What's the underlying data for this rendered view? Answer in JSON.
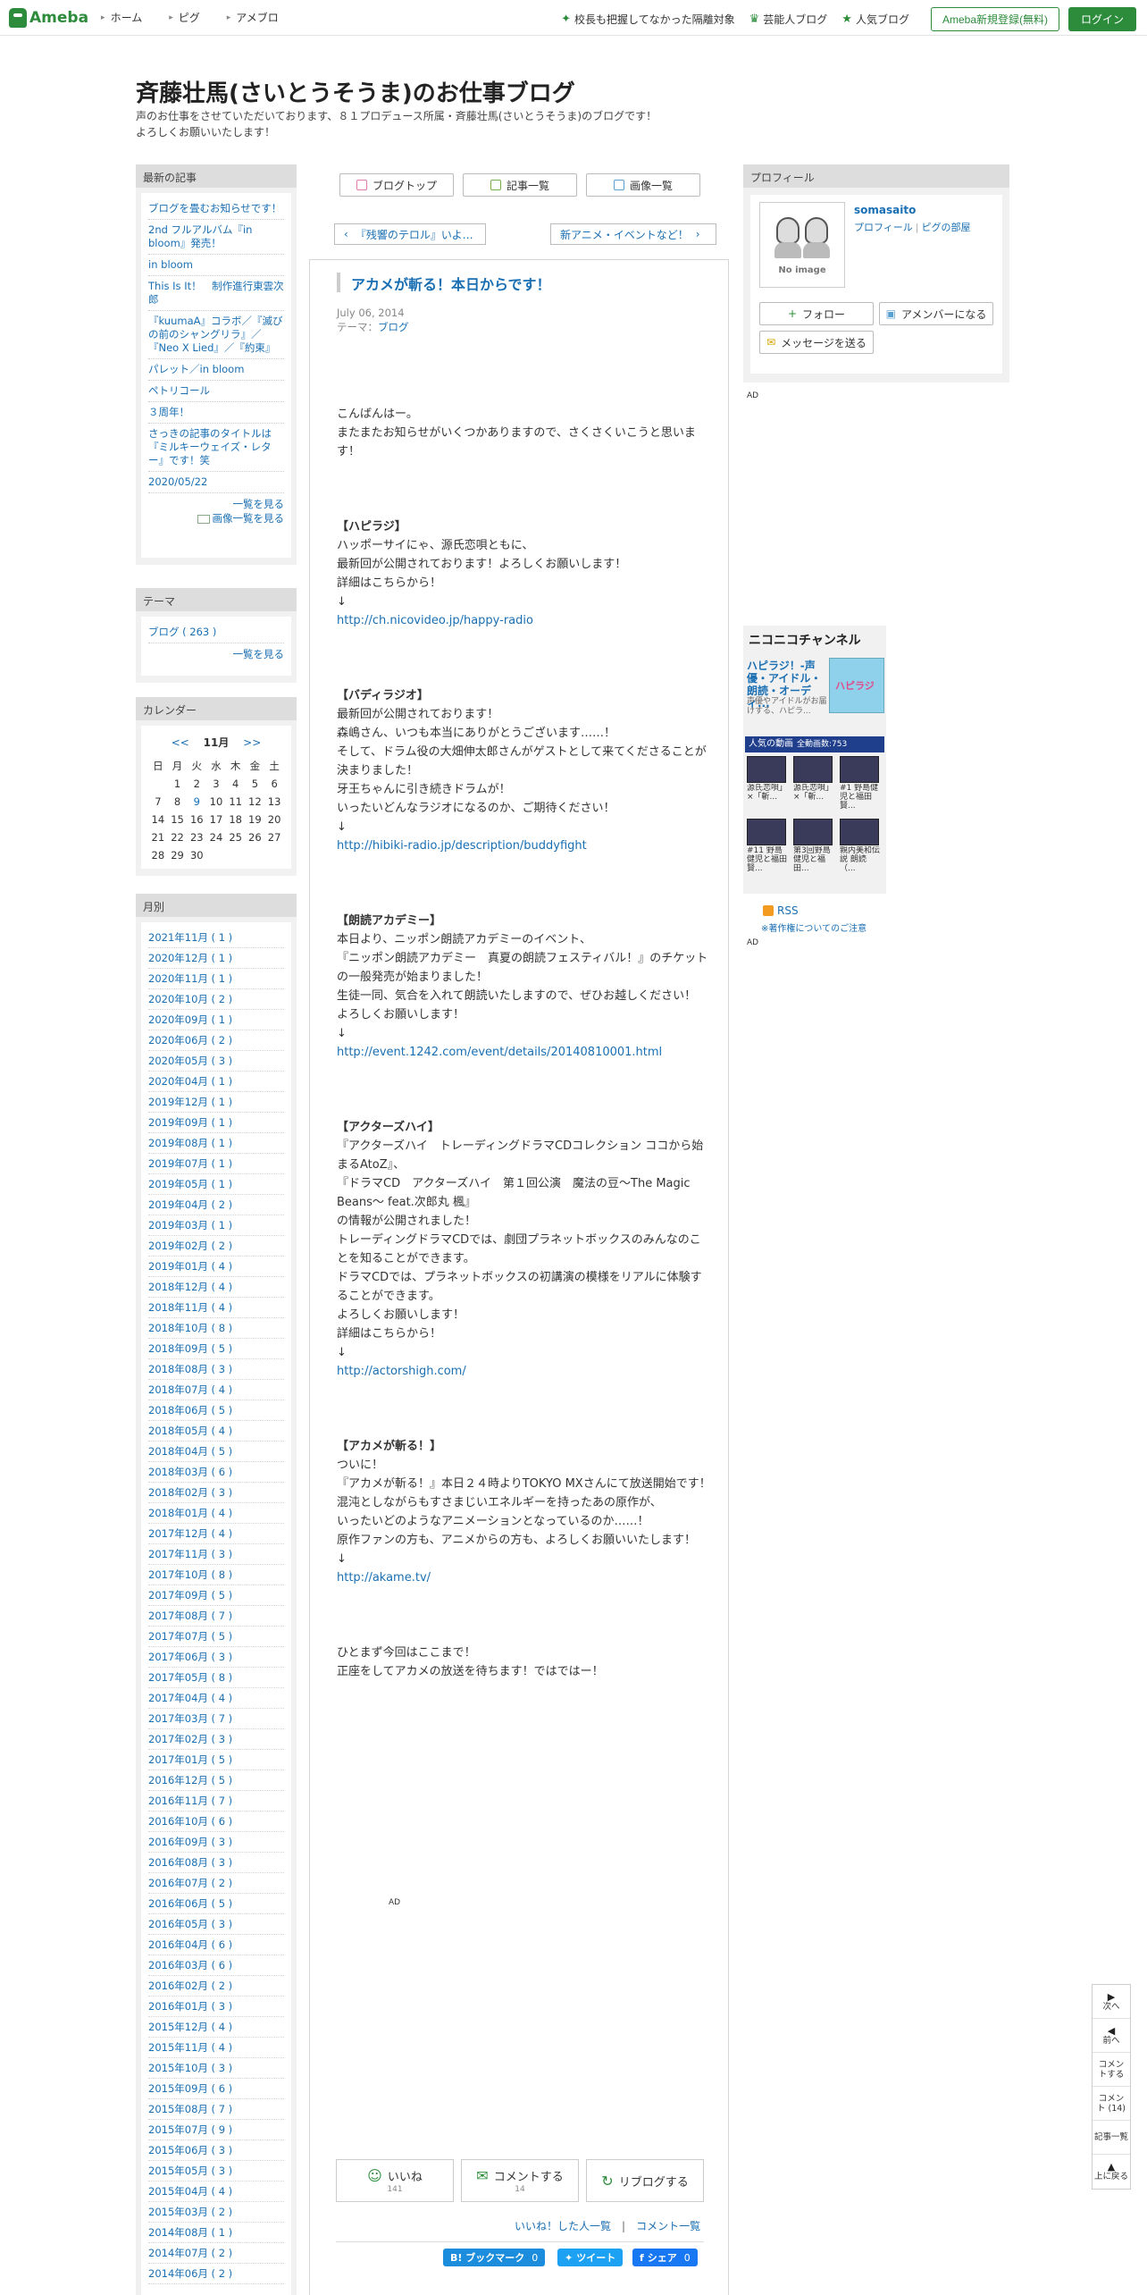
{
  "topbar": {
    "logo": "Ameba",
    "nav": [
      "ホーム",
      "ピグ",
      "アメブロ"
    ],
    "right_links": [
      "校長も把握してなかった隔離対象",
      "芸能人ブログ",
      "人気ブログ"
    ],
    "register": "Ameba新規登録(無料)",
    "login": "ログイン"
  },
  "header": {
    "title": "斉藤壮馬(さいとうそうま)のお仕事ブログ",
    "desc1": "声のお仕事をさせていただいております、８１プロデュース所属・斉藤壮馬(さいとうそうま)のブログです！",
    "desc2": "よろしくお願いいたします！"
  },
  "sidebar": {
    "recent_head": "最新の記事",
    "recent": [
      "ブログを畳むお知らせです！",
      "2nd フルアルバム『in bloom』発売！",
      "in bloom",
      "This Is It！　制作進行東雲次郎",
      "『kuumaA』コラボ／『滅びの前のシャングリラ』／『Neo X Lied』／『約束』",
      "パレット／in bloom",
      "ペトリコール",
      "３周年！",
      "さっきの記事のタイトルは『ミルキーウェイズ・レター』です！笑",
      "2020/05/22"
    ],
    "recent_more": "一覧を見る",
    "recent_img_more": "画像一覧を見る",
    "theme_head": "テーマ",
    "theme_item": "ブログ ( 263 )",
    "theme_more": "一覧を見る",
    "cal_head": "カレンダー",
    "cal_prev": "<<",
    "cal_month": "11月",
    "cal_next": ">>",
    "cal_days": [
      "日",
      "月",
      "火",
      "水",
      "木",
      "金",
      "土"
    ],
    "cal_weeks": [
      [
        "",
        "1",
        "2",
        "3",
        "4",
        "5",
        "6"
      ],
      [
        "7",
        "8",
        "9",
        "10",
        "11",
        "12",
        "13"
      ],
      [
        "14",
        "15",
        "16",
        "17",
        "18",
        "19",
        "20"
      ],
      [
        "21",
        "22",
        "23",
        "24",
        "25",
        "26",
        "27"
      ],
      [
        "28",
        "29",
        "30",
        "",
        "",
        "",
        ""
      ]
    ],
    "monthly_head": "月別",
    "monthly": [
      "2021年11月 ( 1 )",
      "2020年12月 ( 1 )",
      "2020年11月 ( 1 )",
      "2020年10月 ( 2 )",
      "2020年09月 ( 1 )",
      "2020年06月 ( 2 )",
      "2020年05月 ( 3 )",
      "2020年04月 ( 1 )",
      "2019年12月 ( 1 )",
      "2019年09月 ( 1 )",
      "2019年08月 ( 1 )",
      "2019年07月 ( 1 )",
      "2019年05月 ( 1 )",
      "2019年04月 ( 2 )",
      "2019年03月 ( 1 )",
      "2019年02月 ( 2 )",
      "2019年01月 ( 4 )",
      "2018年12月 ( 4 )",
      "2018年11月 ( 4 )",
      "2018年10月 ( 8 )",
      "2018年09月 ( 5 )",
      "2018年08月 ( 3 )",
      "2018年07月 ( 4 )",
      "2018年06月 ( 5 )",
      "2018年05月 ( 4 )",
      "2018年04月 ( 5 )",
      "2018年03月 ( 6 )",
      "2018年02月 ( 3 )",
      "2018年01月 ( 4 )",
      "2017年12月 ( 4 )",
      "2017年11月 ( 3 )",
      "2017年10月 ( 8 )",
      "2017年09月 ( 5 )",
      "2017年08月 ( 7 )",
      "2017年07月 ( 5 )",
      "2017年06月 ( 3 )",
      "2017年05月 ( 8 )",
      "2017年04月 ( 4 )",
      "2017年03月 ( 7 )",
      "2017年02月 ( 3 )",
      "2017年01月 ( 5 )",
      "2016年12月 ( 5 )",
      "2016年11月 ( 7 )",
      "2016年10月 ( 6 )",
      "2016年09月 ( 3 )",
      "2016年08月 ( 3 )",
      "2016年07月 ( 2 )",
      "2016年06月 ( 5 )",
      "2016年05月 ( 3 )",
      "2016年04月 ( 6 )",
      "2016年03月 ( 6 )",
      "2016年02月 ( 2 )",
      "2016年01月 ( 3 )",
      "2015年12月 ( 4 )",
      "2015年11月 ( 4 )",
      "2015年10月 ( 3 )",
      "2015年09月 ( 6 )",
      "2015年08月 ( 7 )",
      "2015年07月 ( 9 )",
      "2015年06月 ( 3 )",
      "2015年05月 ( 3 )",
      "2015年04月 ( 4 )",
      "2015年03月 ( 2 )",
      "2014年08月 ( 1 )",
      "2014年07月 ( 2 )",
      "2014年06月 ( 2 )"
    ]
  },
  "tabs": {
    "top": "ブログトップ",
    "list": "記事一覧",
    "images": "画像一覧"
  },
  "pager": {
    "prev": "『残響のテロル』いよ…",
    "next": "新アニメ・イベントなど！"
  },
  "article": {
    "title": "アカメが斬る！本日からです！",
    "date": "July 06, 2014",
    "theme_label": "テーマ：",
    "theme": "ブログ",
    "intro": [
      "こんばんはー。",
      "またまたお知らせがいくつかありますので、さくさくいこうと思います！"
    ],
    "sec1": {
      "head": "【ハピラジ】",
      "lines": [
        "ハッポーサイにゃ、源氏恋唄ともに、",
        "最新回が公開されております！よろしくお願いします！",
        "詳細はこちらから！",
        "↓"
      ],
      "url": "http://ch.nicovideo.jp/happy-radio"
    },
    "sec2": {
      "head": "【バディラジオ】",
      "lines": [
        "最新回が公開されております！",
        "森嶋さん、いつも本当にありがとうございます……！",
        "そして、ドラム役の大畑伸太郎さんがゲストとして来てくださることが決まりました！",
        "牙王ちゃんに引き続きドラムが！",
        "いったいどんなラジオになるのか、ご期待ください！",
        "↓"
      ],
      "url": "http://hibiki-radio.jp/description/buddyfight"
    },
    "sec3": {
      "head": "【朗読アカデミー】",
      "lines": [
        "本日より、ニッポン朗読アカデミーのイベント、",
        "『ニッポン朗読アカデミー　真夏の朗読フェスティバル！』のチケットの一般発売が始まりました！",
        "生徒一同、気合を入れて朗読いたしますので、ぜひお越しください！",
        "よろしくお願いします！",
        "↓"
      ],
      "url": "http://event.1242.com/event/details/20140810001.html"
    },
    "sec4": {
      "head": "【アクターズハイ】",
      "lines": [
        "『アクターズハイ　トレーディングドラマCDコレクション ココから始まるAtoZ』、",
        "『ドラマCD　アクターズハイ　第１回公演　魔法の豆～The Magic Beans～ feat.次郎丸 楓』",
        "の情報が公開されました！",
        "トレーディングドラマCDでは、劇団プラネットボックスのみんなのことを知ることができます。",
        "ドラマCDでは、プラネットボックスの初講演の模様をリアルに体験することができます。",
        "よろしくお願いします！",
        "詳細はこちらから！",
        "↓"
      ],
      "url": "http://actorshigh.com/"
    },
    "sec5": {
      "head": "【アカメが斬る！】",
      "lines": [
        "ついに！",
        "『アカメが斬る！』本日２４時よりTOKYO MXさんにて放送開始です！",
        "混沌としながらもすさまじいエネルギーを持ったあの原作が、",
        "いったいどのようなアニメーションとなっているのか……！",
        "原作ファンの方も、アニメからの方も、よろしくお願いいたします！",
        "↓"
      ],
      "url": "http://akame.tv/"
    },
    "outro": [
      "ひとまず今回はここまで！",
      "正座をしてアカメの放送を待ちます！ではではー！"
    ],
    "ad": "AD"
  },
  "actions": {
    "like": "いいね",
    "like_count": "141",
    "comment": "コメントする",
    "comment_count": "14",
    "reblog": "リブログする",
    "liked_list": "いいね！した人一覧",
    "comment_list": "コメント一覧"
  },
  "share": {
    "hatena": "B! ブックマーク",
    "hatena_count": "0",
    "tweet": "ツイート",
    "fb": "シェア",
    "fb_count": "0"
  },
  "profile": {
    "head": "プロフィール",
    "noimage": "No image",
    "name": "somasaito",
    "link_profile": "プロフィール",
    "link_room": "ピグの部屋",
    "follow": "フォロー",
    "member": "アメンバーになる",
    "message": "メッセージを送る"
  },
  "right_ad1": "AD",
  "right_ad2": "AD",
  "nico": {
    "logo": "ニコニコチャンネル",
    "title": "ハピラジ！-声優・アイドル・朗読・オーディ...",
    "sub": "声優やアイドルがお届けする、ハピラ...",
    "bar": "人気の動画",
    "bar_count": "全動画数:753",
    "videos": [
      "源氏恋唄」×「斬...",
      "源氏恋唄」×「斬...",
      "#1 野島健児と福田賢...",
      "#11 野島健児と福田賢...",
      "第3回野島健児と福田...",
      "親内美和伝説 朗読（..."
    ]
  },
  "rss": {
    "label": "RSS",
    "note": "※著作権についてのご注意"
  },
  "floatnav": {
    "next": "次へ",
    "prev": "前へ",
    "comment": "コメントする",
    "comments": "コメント (14)",
    "list": "記事一覧",
    "top": "上に戻る"
  }
}
